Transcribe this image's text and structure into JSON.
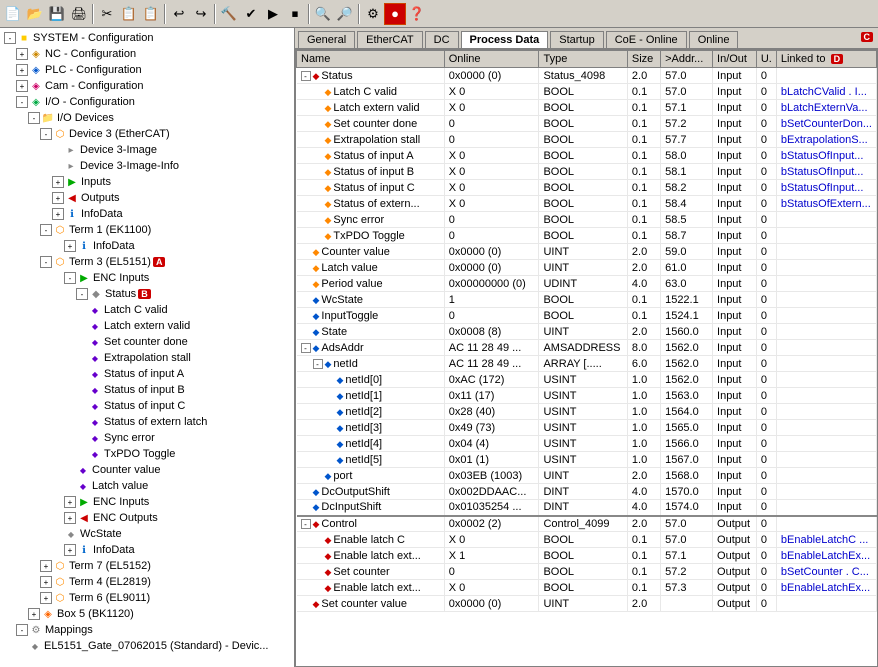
{
  "toolbar": {
    "buttons": [
      "📄",
      "📂",
      "💾",
      "🖨️",
      "✂️",
      "📋",
      "📋",
      "↩️",
      "↪️",
      "🔍",
      "⚙️",
      "🔧",
      "▶️",
      "⏹️",
      "📊",
      "🔎",
      "🔍",
      "🔨",
      "🎯",
      "❓"
    ]
  },
  "tabs": {
    "items": [
      "General",
      "EtherCAT",
      "DC",
      "Process Data",
      "Startup",
      "CoE - Online",
      "Online"
    ],
    "active": "Process Data"
  },
  "tree": {
    "items": [
      {
        "id": "system",
        "label": "SYSTEM - Configuration",
        "level": 0,
        "icon": "folder",
        "expanded": true,
        "has_expand": true
      },
      {
        "id": "nc",
        "label": "NC - Configuration",
        "level": 1,
        "icon": "nc",
        "expanded": false,
        "has_expand": true
      },
      {
        "id": "plc",
        "label": "PLC - Configuration",
        "level": 1,
        "icon": "plc",
        "expanded": false,
        "has_expand": true
      },
      {
        "id": "cam",
        "label": "Cam - Configuration",
        "level": 1,
        "icon": "cam",
        "expanded": false,
        "has_expand": true
      },
      {
        "id": "io",
        "label": "I/O - Configuration",
        "level": 1,
        "icon": "io",
        "expanded": true,
        "has_expand": true
      },
      {
        "id": "iodevices",
        "label": "I/O Devices",
        "level": 2,
        "icon": "folder",
        "expanded": true,
        "has_expand": true
      },
      {
        "id": "dev3",
        "label": "Device 3 (EtherCAT)",
        "level": 3,
        "icon": "ethercat",
        "expanded": true,
        "has_expand": true
      },
      {
        "id": "dev3img",
        "label": "Device 3-Image",
        "level": 4,
        "icon": "status",
        "expanded": false,
        "has_expand": false
      },
      {
        "id": "dev3imginfo",
        "label": "Device 3-Image-Info",
        "level": 4,
        "icon": "status",
        "expanded": false,
        "has_expand": false
      },
      {
        "id": "inputs",
        "label": "Inputs",
        "level": 4,
        "icon": "input",
        "expanded": false,
        "has_expand": true
      },
      {
        "id": "outputs",
        "label": "Outputs",
        "level": 4,
        "icon": "output",
        "expanded": false,
        "has_expand": true
      },
      {
        "id": "infodata",
        "label": "InfoData",
        "level": 4,
        "icon": "info",
        "expanded": false,
        "has_expand": true
      },
      {
        "id": "term1",
        "label": "Term 1 (EK1100)",
        "level": 3,
        "icon": "ethercat",
        "expanded": true,
        "has_expand": true
      },
      {
        "id": "term1info",
        "label": "InfoData",
        "level": 4,
        "icon": "info",
        "expanded": false,
        "has_expand": true
      },
      {
        "id": "term3",
        "label": "Term 3 (EL5151)",
        "level": 3,
        "icon": "ethercat",
        "expanded": true,
        "has_expand": true,
        "badge": "A"
      },
      {
        "id": "enc_inputs",
        "label": "ENC Inputs",
        "level": 4,
        "icon": "input",
        "expanded": true,
        "has_expand": true
      },
      {
        "id": "status",
        "label": "Status",
        "level": 5,
        "icon": "status",
        "expanded": true,
        "has_expand": true,
        "badge": "B"
      },
      {
        "id": "latch_c",
        "label": "Latch C valid",
        "level": 6,
        "icon": "var",
        "expanded": false,
        "has_expand": false
      },
      {
        "id": "latch_ext",
        "label": "Latch extern valid",
        "level": 6,
        "icon": "var",
        "expanded": false,
        "has_expand": false
      },
      {
        "id": "set_counter",
        "label": "Set counter done",
        "level": 6,
        "icon": "var",
        "expanded": false,
        "has_expand": false
      },
      {
        "id": "extrap",
        "label": "Extrapolation stall",
        "level": 6,
        "icon": "var",
        "expanded": false,
        "has_expand": false
      },
      {
        "id": "status_a",
        "label": "Status of input A",
        "level": 6,
        "icon": "var",
        "expanded": false,
        "has_expand": false
      },
      {
        "id": "status_b",
        "label": "Status of input B",
        "level": 6,
        "icon": "var",
        "expanded": false,
        "has_expand": false
      },
      {
        "id": "status_c",
        "label": "Status of input C",
        "level": 6,
        "icon": "var",
        "expanded": false,
        "has_expand": false
      },
      {
        "id": "status_ext",
        "label": "Status of extern latch",
        "level": 6,
        "icon": "var",
        "expanded": false,
        "has_expand": false
      },
      {
        "id": "sync_err",
        "label": "Sync error",
        "level": 6,
        "icon": "var",
        "expanded": false,
        "has_expand": false
      },
      {
        "id": "txpdo",
        "label": "TxPDO Toggle",
        "level": 6,
        "icon": "var",
        "expanded": false,
        "has_expand": false
      },
      {
        "id": "counter_val",
        "label": "Counter value",
        "level": 4,
        "icon": "var",
        "expanded": false,
        "has_expand": false
      },
      {
        "id": "latch_val",
        "label": "Latch value",
        "level": 4,
        "icon": "var",
        "expanded": false,
        "has_expand": false
      },
      {
        "id": "enc_inputs2",
        "label": "ENC Inputs",
        "level": 4,
        "icon": "input",
        "expanded": false,
        "has_expand": true
      },
      {
        "id": "enc_outputs",
        "label": "ENC Outputs",
        "level": 4,
        "icon": "output",
        "expanded": false,
        "has_expand": true
      },
      {
        "id": "wcstate",
        "label": "WcState",
        "level": 4,
        "icon": "status",
        "expanded": false,
        "has_expand": false
      },
      {
        "id": "infodata2",
        "label": "InfoData",
        "level": 4,
        "icon": "info",
        "expanded": false,
        "has_expand": true
      },
      {
        "id": "term7",
        "label": "Term 7 (EL5152)",
        "level": 3,
        "icon": "ethercat",
        "expanded": false,
        "has_expand": true
      },
      {
        "id": "term4",
        "label": "Term 4 (EL2819)",
        "level": 3,
        "icon": "ethercat",
        "expanded": false,
        "has_expand": true
      },
      {
        "id": "term6",
        "label": "Term 6 (EL9011)",
        "level": 3,
        "icon": "ethercat",
        "expanded": false,
        "has_expand": true
      },
      {
        "id": "box5",
        "label": "Box 5 (BK1120)",
        "level": 2,
        "icon": "device",
        "expanded": false,
        "has_expand": true
      },
      {
        "id": "mappings",
        "label": "Mappings",
        "level": 1,
        "icon": "gear",
        "expanded": false,
        "has_expand": true
      },
      {
        "id": "el5151gate",
        "label": "EL5151_Gate_07062015 (Standard) - Devic...",
        "level": 2,
        "icon": "gear",
        "expanded": false,
        "has_expand": false
      }
    ]
  },
  "table": {
    "columns": [
      "Name",
      "Online",
      "Type",
      "Size",
      ">Addr...",
      "In/Out",
      "U.",
      "Linked to"
    ],
    "rows": [
      {
        "name": "Status",
        "online": "0x0000 (0)",
        "type": "Status_4098",
        "size": "2.0",
        "addr": "57.0",
        "inout": "Input",
        "u": "0",
        "linked": "",
        "indent": 0,
        "icon": "diamond-red",
        "has_expand": true,
        "expanded": true
      },
      {
        "name": "Latch C valid",
        "online": "X 0",
        "type": "BOOL",
        "size": "0.1",
        "addr": "57.0",
        "inout": "Input",
        "u": "0",
        "linked": "bLatchCValid . I...",
        "indent": 1,
        "icon": "diamond-orange"
      },
      {
        "name": "Latch extern valid",
        "online": "X 0",
        "type": "BOOL",
        "size": "0.1",
        "addr": "57.1",
        "inout": "Input",
        "u": "0",
        "linked": "bLatchExternVa...",
        "indent": 1,
        "icon": "diamond-orange"
      },
      {
        "name": "Set counter done",
        "online": "0",
        "type": "BOOL",
        "size": "0.1",
        "addr": "57.2",
        "inout": "Input",
        "u": "0",
        "linked": "bSetCounterDon...",
        "indent": 1,
        "icon": "diamond-orange"
      },
      {
        "name": "Extrapolation stall",
        "online": "0",
        "type": "BOOL",
        "size": "0.1",
        "addr": "57.7",
        "inout": "Input",
        "u": "0",
        "linked": "bExtrapolationS...",
        "indent": 1,
        "icon": "diamond-orange"
      },
      {
        "name": "Status of input A",
        "online": "X 0",
        "type": "BOOL",
        "size": "0.1",
        "addr": "58.0",
        "inout": "Input",
        "u": "0",
        "linked": "bStatusOfInput...",
        "indent": 1,
        "icon": "diamond-orange"
      },
      {
        "name": "Status of input B",
        "online": "X 0",
        "type": "BOOL",
        "size": "0.1",
        "addr": "58.1",
        "inout": "Input",
        "u": "0",
        "linked": "bStatusOfInput...",
        "indent": 1,
        "icon": "diamond-orange"
      },
      {
        "name": "Status of input C",
        "online": "X 0",
        "type": "BOOL",
        "size": "0.1",
        "addr": "58.2",
        "inout": "Input",
        "u": "0",
        "linked": "bStatusOfInput...",
        "indent": 1,
        "icon": "diamond-orange"
      },
      {
        "name": "Status of extern...",
        "online": "X 0",
        "type": "BOOL",
        "size": "0.1",
        "addr": "58.4",
        "inout": "Input",
        "u": "0",
        "linked": "bStatusOfExtern...",
        "indent": 1,
        "icon": "diamond-orange"
      },
      {
        "name": "Sync error",
        "online": "0",
        "type": "BOOL",
        "size": "0.1",
        "addr": "58.5",
        "inout": "Input",
        "u": "0",
        "linked": "",
        "indent": 1,
        "icon": "diamond-orange"
      },
      {
        "name": "TxPDO Toggle",
        "online": "0",
        "type": "BOOL",
        "size": "0.1",
        "addr": "58.7",
        "inout": "Input",
        "u": "0",
        "linked": "",
        "indent": 1,
        "icon": "diamond-orange"
      },
      {
        "name": "Counter value",
        "online": "0x0000 (0)",
        "type": "UINT",
        "size": "2.0",
        "addr": "59.0",
        "inout": "Input",
        "u": "0",
        "linked": "",
        "indent": 0,
        "icon": "diamond-orange"
      },
      {
        "name": "Latch value",
        "online": "0x0000 (0)",
        "type": "UINT",
        "size": "2.0",
        "addr": "61.0",
        "inout": "Input",
        "u": "0",
        "linked": "",
        "indent": 0,
        "icon": "diamond-orange"
      },
      {
        "name": "Period value",
        "online": "0x00000000 (0)",
        "type": "UDINT",
        "size": "4.0",
        "addr": "63.0",
        "inout": "Input",
        "u": "0",
        "linked": "",
        "indent": 0,
        "icon": "diamond-orange"
      },
      {
        "name": "WcState",
        "online": "1",
        "type": "BOOL",
        "size": "0.1",
        "addr": "1522.1",
        "inout": "Input",
        "u": "0",
        "linked": "",
        "indent": 0,
        "icon": "diamond-blue"
      },
      {
        "name": "InputToggle",
        "online": "0",
        "type": "BOOL",
        "size": "0.1",
        "addr": "1524.1",
        "inout": "Input",
        "u": "0",
        "linked": "",
        "indent": 0,
        "icon": "diamond-blue"
      },
      {
        "name": "State",
        "online": "0x0008 (8)",
        "type": "UINT",
        "size": "2.0",
        "addr": "1560.0",
        "inout": "Input",
        "u": "0",
        "linked": "",
        "indent": 0,
        "icon": "diamond-blue"
      },
      {
        "name": "AdsAddr",
        "online": "AC 11 28 49 ...",
        "type": "AMSADDRESS",
        "size": "8.0",
        "addr": "1562.0",
        "inout": "Input",
        "u": "0",
        "linked": "",
        "indent": 0,
        "icon": "diamond-blue",
        "has_expand": true,
        "expanded": true
      },
      {
        "name": "netId",
        "online": "AC 11 28 49 ...",
        "type": "ARRAY [.....",
        "size": "6.0",
        "addr": "1562.0",
        "inout": "Input",
        "u": "0",
        "linked": "",
        "indent": 1,
        "icon": "diamond-blue",
        "has_expand": true,
        "expanded": true
      },
      {
        "name": "netId[0]",
        "online": "0xAC (172)",
        "type": "USINT",
        "size": "1.0",
        "addr": "1562.0",
        "inout": "Input",
        "u": "0",
        "linked": "",
        "indent": 2,
        "icon": "diamond-blue"
      },
      {
        "name": "netId[1]",
        "online": "0x11 (17)",
        "type": "USINT",
        "size": "1.0",
        "addr": "1563.0",
        "inout": "Input",
        "u": "0",
        "linked": "",
        "indent": 2,
        "icon": "diamond-blue"
      },
      {
        "name": "netId[2]",
        "online": "0x28 (40)",
        "type": "USINT",
        "size": "1.0",
        "addr": "1564.0",
        "inout": "Input",
        "u": "0",
        "linked": "",
        "indent": 2,
        "icon": "diamond-blue"
      },
      {
        "name": "netId[3]",
        "online": "0x49 (73)",
        "type": "USINT",
        "size": "1.0",
        "addr": "1565.0",
        "inout": "Input",
        "u": "0",
        "linked": "",
        "indent": 2,
        "icon": "diamond-blue"
      },
      {
        "name": "netId[4]",
        "online": "0x04 (4)",
        "type": "USINT",
        "size": "1.0",
        "addr": "1566.0",
        "inout": "Input",
        "u": "0",
        "linked": "",
        "indent": 2,
        "icon": "diamond-blue"
      },
      {
        "name": "netId[5]",
        "online": "0x01 (1)",
        "type": "USINT",
        "size": "1.0",
        "addr": "1567.0",
        "inout": "Input",
        "u": "0",
        "linked": "",
        "indent": 2,
        "icon": "diamond-blue"
      },
      {
        "name": "port",
        "online": "0x03EB (1003)",
        "type": "UINT",
        "size": "2.0",
        "addr": "1568.0",
        "inout": "Input",
        "u": "0",
        "linked": "",
        "indent": 1,
        "icon": "diamond-blue"
      },
      {
        "name": "DcOutputShift",
        "online": "0x002DDAAC...",
        "type": "DINT",
        "size": "4.0",
        "addr": "1570.0",
        "inout": "Input",
        "u": "0",
        "linked": "",
        "indent": 0,
        "icon": "diamond-blue"
      },
      {
        "name": "DcInputShift",
        "online": "0x01035254 ...",
        "type": "DINT",
        "size": "4.0",
        "addr": "1574.0",
        "inout": "Input",
        "u": "0",
        "linked": "",
        "indent": 0,
        "icon": "diamond-blue"
      },
      {
        "name": "Control",
        "online": "0x0002 (2)",
        "type": "Control_4099",
        "size": "2.0",
        "addr": "57.0",
        "inout": "Output",
        "u": "0",
        "linked": "",
        "indent": 0,
        "icon": "diamond-red",
        "has_expand": true,
        "expanded": true
      },
      {
        "name": "Enable latch C",
        "online": "X 0",
        "type": "BOOL",
        "size": "0.1",
        "addr": "57.0",
        "inout": "Output",
        "u": "0",
        "linked": "bEnableLatchC ...",
        "indent": 1,
        "icon": "diamond-red"
      },
      {
        "name": "Enable latch ext...",
        "online": "X 1",
        "type": "BOOL",
        "size": "0.1",
        "addr": "57.1",
        "inout": "Output",
        "u": "0",
        "linked": "bEnableLatchEx...",
        "indent": 1,
        "icon": "diamond-red"
      },
      {
        "name": "Set counter",
        "online": "0",
        "type": "BOOL",
        "size": "0.1",
        "addr": "57.2",
        "inout": "Output",
        "u": "0",
        "linked": "bSetCounter . C...",
        "indent": 1,
        "icon": "diamond-red"
      },
      {
        "name": "Enable latch ext...",
        "online": "X 0",
        "type": "BOOL",
        "size": "0.1",
        "addr": "57.3",
        "inout": "Output",
        "u": "0",
        "linked": "bEnableLatchEx...",
        "indent": 1,
        "icon": "diamond-red"
      },
      {
        "name": "Set counter value",
        "online": "0x0000 (0)",
        "type": "UINT",
        "size": "2.0",
        "addr": "",
        "inout": "Output",
        "u": "0",
        "linked": "",
        "indent": 0,
        "icon": "diamond-red"
      }
    ]
  },
  "badges": {
    "A": "A",
    "B": "B",
    "C": "C",
    "D": "D"
  },
  "icons": {
    "expand": "+",
    "collapse": "-",
    "folder": "📁",
    "gear": "⚙",
    "diamond_red": "◆",
    "diamond_orange": "◆",
    "diamond_blue": "◆",
    "arrow_right": "▶",
    "arrow_down": "▼"
  }
}
